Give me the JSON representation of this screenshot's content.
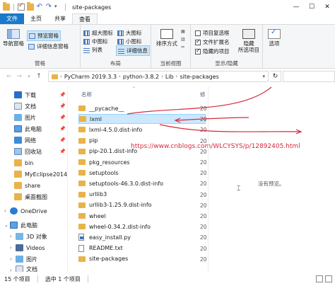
{
  "window": {
    "title": "site-packages",
    "minimize": "—",
    "maximize": "☐",
    "close": "✕"
  },
  "tabs": [
    {
      "label": "文件"
    },
    {
      "label": "主页"
    },
    {
      "label": "共享"
    },
    {
      "label": "查看"
    }
  ],
  "ribbon": {
    "panes": {
      "nav_pane": "导航窗格",
      "preview_pane": "预览窗格",
      "details_pane": "详细信息窗格",
      "label": "窗格"
    },
    "layout": {
      "xl_icons": "超大图标",
      "large_icons": "大图标",
      "medium_icons": "中图标",
      "small_icons": "小图标",
      "list": "列表",
      "details": "详细信息",
      "label": "布局"
    },
    "sort": {
      "sort_by": "排序方式",
      "label": "当前视图"
    },
    "show_hide": {
      "item_checkboxes": "项目复选框",
      "file_extensions": "文件扩展名",
      "hidden_items": "隐藏的项目",
      "hide_selected": "隐藏",
      "hide_selected_2": "所选项目",
      "label": "显示/隐藏",
      "item_checkboxes_on": false,
      "file_extensions_on": true,
      "hidden_items_on": true
    },
    "options": {
      "label": "选项"
    }
  },
  "address": {
    "crumbs": [
      "PyCharm 2019.3.3",
      "python-3.8.2",
      "Lib",
      "site-packages"
    ]
  },
  "sidebar": {
    "items": [
      {
        "label": "下载",
        "icon": "download-icon"
      },
      {
        "label": "文档",
        "icon": "document-icon"
      },
      {
        "label": "图片",
        "icon": "picture-icon"
      },
      {
        "label": "此电脑",
        "icon": "computer-icon"
      },
      {
        "label": "网络",
        "icon": "network-icon"
      },
      {
        "label": "回收站",
        "icon": "recycle-bin-icon"
      },
      {
        "label": "bin",
        "icon": "folder-icon"
      },
      {
        "label": "MyEclipse2014",
        "icon": "folder-icon"
      },
      {
        "label": "share",
        "icon": "folder-icon"
      },
      {
        "label": "桌面截图",
        "icon": "folder-icon"
      },
      {
        "label": "OneDrive",
        "icon": "onedrive-icon"
      },
      {
        "label": "此电脑",
        "icon": "computer-icon"
      },
      {
        "label": "3D 对象",
        "icon": "3d-objects-icon"
      },
      {
        "label": "Videos",
        "icon": "video-icon"
      },
      {
        "label": "图片",
        "icon": "picture-icon"
      },
      {
        "label": "文档",
        "icon": "document-icon"
      }
    ]
  },
  "content": {
    "col_name": "名称",
    "col_modified": "修",
    "files": [
      {
        "name": "__pycache__",
        "type": "folder",
        "date": "20"
      },
      {
        "name": "lxml",
        "type": "folder",
        "date": "20",
        "selected": true
      },
      {
        "name": "lxml-4.5.0.dist-info",
        "type": "folder",
        "date": "20"
      },
      {
        "name": "pip",
        "type": "folder",
        "date": "20"
      },
      {
        "name": "pip-20.1.dist-info",
        "type": "folder",
        "date": "20"
      },
      {
        "name": "pkg_resources",
        "type": "folder",
        "date": "20"
      },
      {
        "name": "setuptools",
        "type": "folder",
        "date": "20"
      },
      {
        "name": "setuptools-46.3.0.dist-info",
        "type": "folder",
        "date": "20"
      },
      {
        "name": "urllib3",
        "type": "folder",
        "date": "20"
      },
      {
        "name": "urllib3-1.25.9.dist-info",
        "type": "folder",
        "date": "20"
      },
      {
        "name": "wheel",
        "type": "folder",
        "date": "20"
      },
      {
        "name": "wheel-0.34.2.dist-info",
        "type": "folder",
        "date": "20"
      },
      {
        "name": "easy_install.py",
        "type": "python",
        "date": "20"
      },
      {
        "name": "README.txt",
        "type": "text",
        "date": "20"
      },
      {
        "name": "site-packages",
        "type": "folder",
        "date": "20"
      }
    ],
    "preview_text": "没有预览。",
    "watermark": "https://www.cnblogs.com/WLCYSYS/p/12892405.html"
  },
  "status": {
    "count": "15 个项目",
    "selected": "选中 1 个项目"
  },
  "colors": {
    "file_tab": "#1979ca",
    "selected_row": "#cce8ff",
    "annotation": "#d62a3c"
  }
}
